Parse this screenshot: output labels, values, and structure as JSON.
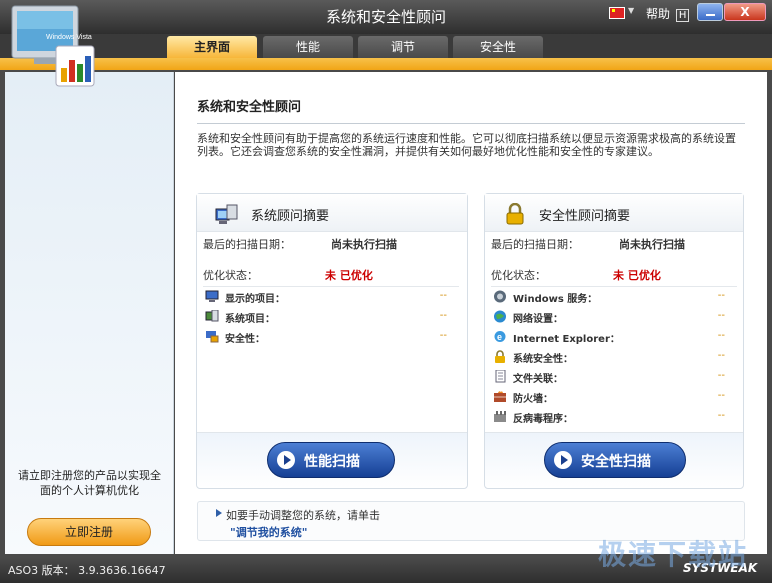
{
  "window": {
    "title": "系统和安全性顾问",
    "help_label": "帮助",
    "help_key": "H",
    "close_label": "X",
    "brand_short": "aso",
    "logo_text": "Windows Vista"
  },
  "tabs": [
    {
      "label": "主界面",
      "active": true
    },
    {
      "label": "性能",
      "active": false
    },
    {
      "label": "调节",
      "active": false
    },
    {
      "label": "安全性",
      "active": false
    }
  ],
  "sidebar": {
    "promo_text": "请立即注册您的产品以实现全面的个人计算机优化",
    "register_label": "立即注册"
  },
  "main": {
    "title": "系统和安全性顾问",
    "intro": "系统和安全性顾问有助于提高您的系统运行速度和性能。它可以彻底扫描系统以便显示资源需求极高的系统设置列表。它还会调查您系统的安全性漏洞，并提供有关如何最好地优化性能和安全性的专家建议。",
    "system_panel": {
      "title": "系统顾问摘要",
      "last_scan_label": "最后的扫描日期：",
      "last_scan_value": "尚未执行扫描",
      "status_label": "优化状态：",
      "status_value": "未 已优化",
      "items": [
        {
          "label": "显示的项目：",
          "value": "--"
        },
        {
          "label": "系统项目：",
          "value": "--"
        },
        {
          "label": "安全性：",
          "value": "--"
        }
      ],
      "scan_label": "性能扫描"
    },
    "security_panel": {
      "title": "安全性顾问摘要",
      "last_scan_label": "最后的扫描日期：",
      "last_scan_value": "尚未执行扫描",
      "status_label": "优化状态：",
      "status_value": "未 已优化",
      "items": [
        {
          "label": "Windows 服务：",
          "value": "--"
        },
        {
          "label": "网络设置：",
          "value": "--"
        },
        {
          "label": "Internet Explorer：",
          "value": "--"
        },
        {
          "label": "系统安全性：",
          "value": "--"
        },
        {
          "label": "文件关联：",
          "value": "--"
        },
        {
          "label": "防火墙：",
          "value": "--"
        },
        {
          "label": "反病毒程序：",
          "value": "--"
        }
      ],
      "scan_label": "安全性扫描"
    },
    "hint": {
      "text": "如要手动调整您的系统，请单击",
      "link": "\"调节我的系统\""
    }
  },
  "status": {
    "version": "ASO3 版本： 3.9.3636.16647",
    "brand": "SYSTWEAK",
    "watermark": "极速下载站"
  },
  "colors": {
    "accent_orange": "#f7b63a",
    "scan_blue": "#153f94",
    "warning_red": "#cc0000"
  }
}
